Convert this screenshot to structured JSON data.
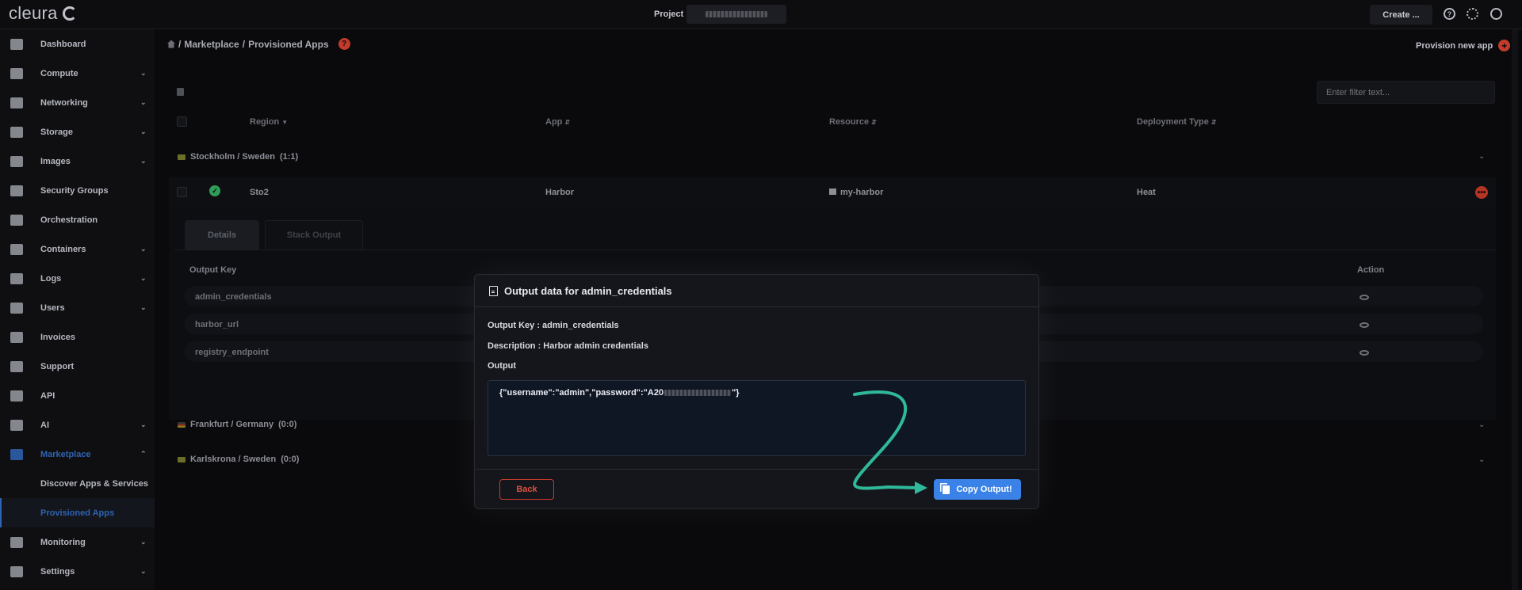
{
  "topbar": {
    "logo_text": "cleura",
    "project_label": "Project",
    "create_label": "Create ...",
    "icons": [
      "help-icon",
      "gear-icon",
      "user-icon"
    ]
  },
  "sidebar": {
    "items": [
      {
        "label": "Dashboard",
        "icon": "chart-icon",
        "has_chevron": false
      },
      {
        "label": "Compute",
        "icon": "server-icon",
        "has_chevron": true
      },
      {
        "label": "Networking",
        "icon": "network-icon",
        "has_chevron": true
      },
      {
        "label": "Storage",
        "icon": "database-icon",
        "has_chevron": true
      },
      {
        "label": "Images",
        "icon": "camera-icon",
        "has_chevron": true
      },
      {
        "label": "Security Groups",
        "icon": "shield-icon",
        "has_chevron": false
      },
      {
        "label": "Orchestration",
        "icon": "orchestration-icon",
        "has_chevron": false
      },
      {
        "label": "Containers",
        "icon": "box-icon",
        "has_chevron": true
      },
      {
        "label": "Logs",
        "icon": "history-icon",
        "has_chevron": true
      },
      {
        "label": "Users",
        "icon": "user-icon",
        "has_chevron": true
      },
      {
        "label": "Invoices",
        "icon": "calculator-icon",
        "has_chevron": false
      },
      {
        "label": "Support",
        "icon": "lifebuoy-icon",
        "has_chevron": false
      },
      {
        "label": "API",
        "icon": "plug-icon",
        "has_chevron": false
      },
      {
        "label": "AI",
        "icon": "ai-icon",
        "has_chevron": true
      },
      {
        "label": "Marketplace",
        "icon": "cart-icon",
        "has_chevron": true
      },
      {
        "label": "Discover Apps & Services",
        "sub": true
      },
      {
        "label": "Provisioned Apps",
        "sub": true
      },
      {
        "label": "Monitoring",
        "icon": "line-chart-icon",
        "has_chevron": true
      },
      {
        "label": "Settings",
        "icon": "gear-icon",
        "has_chevron": true
      }
    ]
  },
  "breadcrumb": {
    "parts": [
      "Marketplace",
      "Provisioned Apps"
    ],
    "separator": "/"
  },
  "provision_label": "Provision new app",
  "filter_placeholder": "Enter filter text...",
  "table": {
    "headers": [
      "Region",
      "App",
      "Resource",
      "Deployment Type"
    ],
    "groups": [
      {
        "label": "Stockholm / Sweden",
        "count": "(1:1)"
      },
      {
        "label": "Frankfurt / Germany",
        "count": "(0:0)"
      },
      {
        "label": "Karlskrona / Sweden",
        "count": "(0:0)"
      }
    ],
    "row": {
      "region": "Sto2",
      "app": "Harbor",
      "resource": "my-harbor",
      "deployment_type": "Heat"
    }
  },
  "detail": {
    "tabs": [
      "Details",
      "Stack Output"
    ],
    "output_headers": {
      "key": "Output Key",
      "action": "Action"
    },
    "outputs": [
      "admin_credentials",
      "harbor_url",
      "registry_endpoint"
    ]
  },
  "modal": {
    "title": "Output data for admin_credentials",
    "output_key_line": "Output Key : admin_credentials",
    "description_line": "Description : Harbor admin credentials",
    "output_label": "Output",
    "output_prefix": "{\"username\":\"admin\",\"password\":\"A20",
    "output_suffix": "\"}",
    "back_label": "Back",
    "copy_label": "Copy Output!"
  },
  "colors": {
    "accent": "#3b82e8",
    "danger": "#c43c2c",
    "success": "#2f9d5a",
    "annotation_arrow": "#2fb89a",
    "active_nav": "#2f63b3"
  }
}
